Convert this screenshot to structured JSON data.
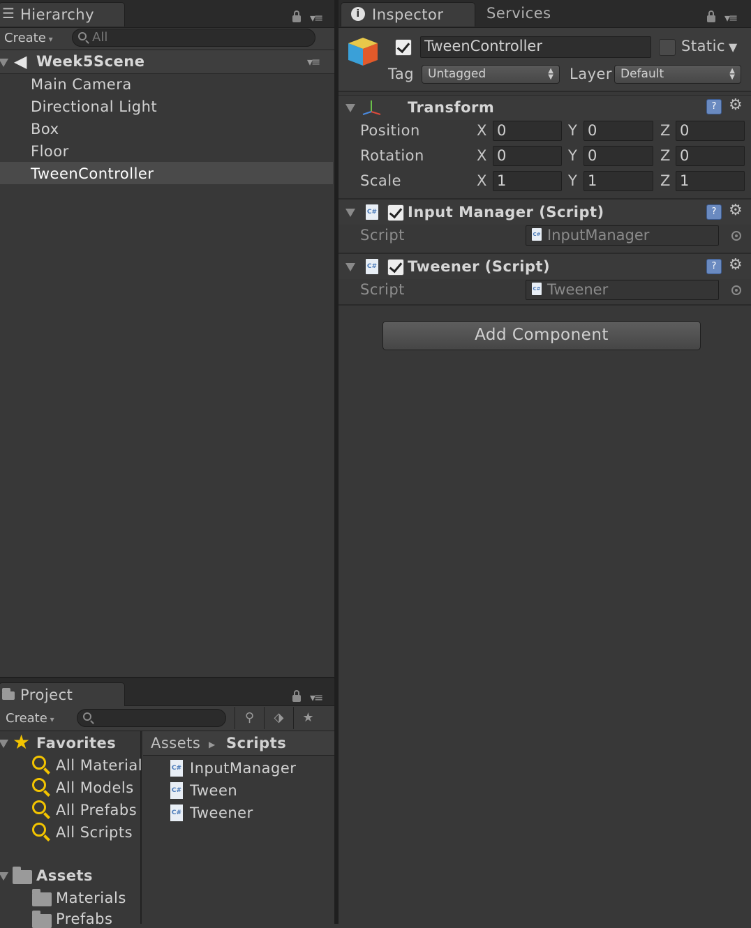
{
  "hierarchy": {
    "tab_label": "Hierarchy",
    "create_label": "Create",
    "search_placeholder": "All",
    "scene_name": "Week5Scene",
    "items": [
      "Main Camera",
      "Directional Light",
      "Box",
      "Floor",
      "TweenController"
    ],
    "selected_item": "TweenController"
  },
  "inspector": {
    "tab_label": "Inspector",
    "services_tab_label": "Services",
    "object_name": "TweenController",
    "active": true,
    "static_label": "Static",
    "static_checked": false,
    "tag_label": "Tag",
    "tag_value": "Untagged",
    "layer_label": "Layer",
    "layer_value": "Default",
    "transform": {
      "title": "Transform",
      "position_label": "Position",
      "rotation_label": "Rotation",
      "scale_label": "Scale",
      "axis_x": "X",
      "axis_y": "Y",
      "axis_z": "Z",
      "position": [
        "0",
        "0",
        "0"
      ],
      "rotation": [
        "0",
        "0",
        "0"
      ],
      "scale": [
        "1",
        "1",
        "1"
      ]
    },
    "components": [
      {
        "title": "Input Manager (Script)",
        "enabled": true,
        "script_label": "Script",
        "script_value": "InputManager"
      },
      {
        "title": "Tweener (Script)",
        "enabled": true,
        "script_label": "Script",
        "script_value": "Tweener"
      }
    ],
    "add_component_label": "Add Component"
  },
  "project": {
    "tab_label": "Project",
    "create_label": "Create",
    "favorites_label": "Favorites",
    "favorites": [
      "All Materials",
      "All Models",
      "All Prefabs",
      "All Scripts"
    ],
    "assets_label": "Assets",
    "asset_folders": [
      "Materials",
      "Prefabs"
    ],
    "breadcrumb_root": "Assets",
    "breadcrumb_current": "Scripts",
    "files": [
      "InputManager",
      "Tween",
      "Tweener"
    ]
  },
  "colors": {
    "selection_bg": "#4a4a4a",
    "favorite_yellow": "#f3c400"
  },
  "icons": [
    "hierarchy-list-icon",
    "lock-icon",
    "panel-menu-icon",
    "unity-logo-icon",
    "info-icon",
    "cube-icon",
    "transform-axes-icon",
    "help-icon",
    "gear-icon",
    "script-icon",
    "object-picker-icon",
    "folder-icon",
    "star-icon",
    "magnify-icon",
    "csharp-file-icon"
  ]
}
